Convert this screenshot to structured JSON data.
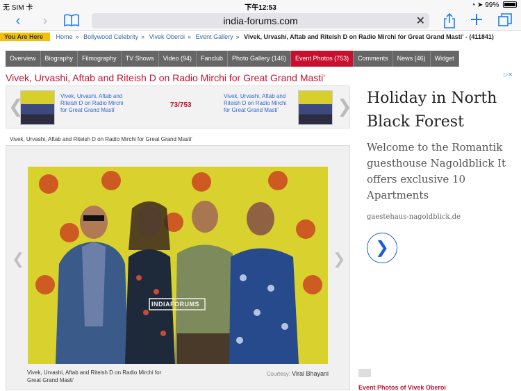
{
  "status": {
    "carrier": "无 SIM 卡 ",
    "time": "下午12:53",
    "battery": "99%"
  },
  "browser": {
    "url": "india-forums.com",
    "clear": "✕"
  },
  "breadcrumb": {
    "you_are_here": "You Are Here",
    "items": [
      "Home",
      "Bollywood Celebrity",
      "Vivek Oberoi",
      "Event Gallery"
    ],
    "current": "Vivek, Urvashi, Aftab and Riteish D on Radio Mirchi for Great Grand Masti' - (411841)"
  },
  "tabs": [
    {
      "label": "Overview"
    },
    {
      "label": "Biography"
    },
    {
      "label": "Filmography"
    },
    {
      "label": "TV Shows"
    },
    {
      "label": "Video  (94)"
    },
    {
      "label": "Fanclub"
    },
    {
      "label": "Photo Gallery  (146)"
    },
    {
      "label": "Event Photos  (753)",
      "active": true
    },
    {
      "label": "Comments"
    },
    {
      "label": "News  (46)"
    },
    {
      "label": "Widget"
    }
  ],
  "article": {
    "title": "Vivek, Urvashi, Aftab and Riteish D on Radio Mirchi for Great Grand Masti'",
    "counter": "73/753",
    "prev_link": "Vivek, Urvashi, Aftab and Riteish D on Radio Mirchi for Great Grand Masti'",
    "next_link": "Vivek, Urvashi, Aftab and Riteish D on Radio Mirchi for Great Grand Masti'",
    "caption_top": "Vivek, Urvashi, Aftab and Riteish D on Radio Mirchi for Great Grand Masti'",
    "photo_caption": "Vivek, Urvashi, Aftab and Riteish D on Radio Mirchi for Great Grand Masti'",
    "courtesy_label": "Courtesy:",
    "courtesy_name": "Viral Bhayani",
    "watermark": "INDIAFORUMS"
  },
  "ad": {
    "headline": "Holiday in North Black Forest",
    "body": "Welcome to the Romantik guesthouse Nagoldblick It offers exclusive 10 Apartments",
    "domain": "gaestehaus-nagoldblick.de",
    "badge": "▷✕"
  },
  "sidebar": {
    "heading": "Event Photos of Vivek Oberoi"
  },
  "colors": {
    "accent": "#c8102e",
    "ios_blue": "#1a7cf5",
    "breadcrumb_tag": "#f5c000"
  }
}
